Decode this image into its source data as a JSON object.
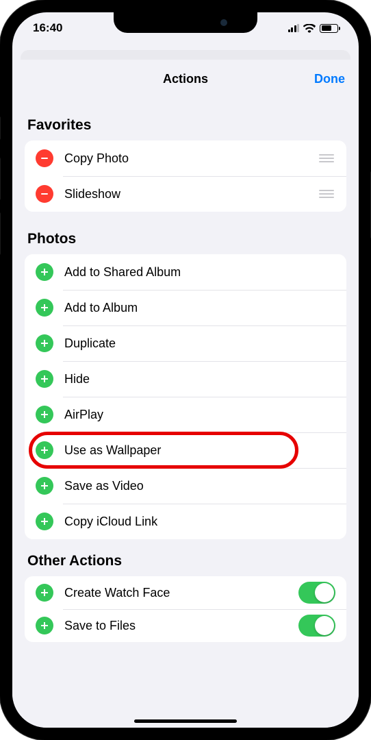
{
  "status": {
    "time": "16:40"
  },
  "nav": {
    "title": "Actions",
    "done": "Done"
  },
  "sections": {
    "favorites": {
      "header": "Favorites",
      "items": [
        {
          "label": "Copy Photo"
        },
        {
          "label": "Slideshow"
        }
      ]
    },
    "photos": {
      "header": "Photos",
      "items": [
        {
          "label": "Add to Shared Album"
        },
        {
          "label": "Add to Album"
        },
        {
          "label": "Duplicate"
        },
        {
          "label": "Hide"
        },
        {
          "label": "AirPlay"
        },
        {
          "label": "Use as Wallpaper"
        },
        {
          "label": "Save as Video"
        },
        {
          "label": "Copy iCloud Link"
        }
      ]
    },
    "other": {
      "header": "Other Actions",
      "items": [
        {
          "label": "Create Watch Face"
        },
        {
          "label": "Save to Files"
        }
      ]
    }
  }
}
